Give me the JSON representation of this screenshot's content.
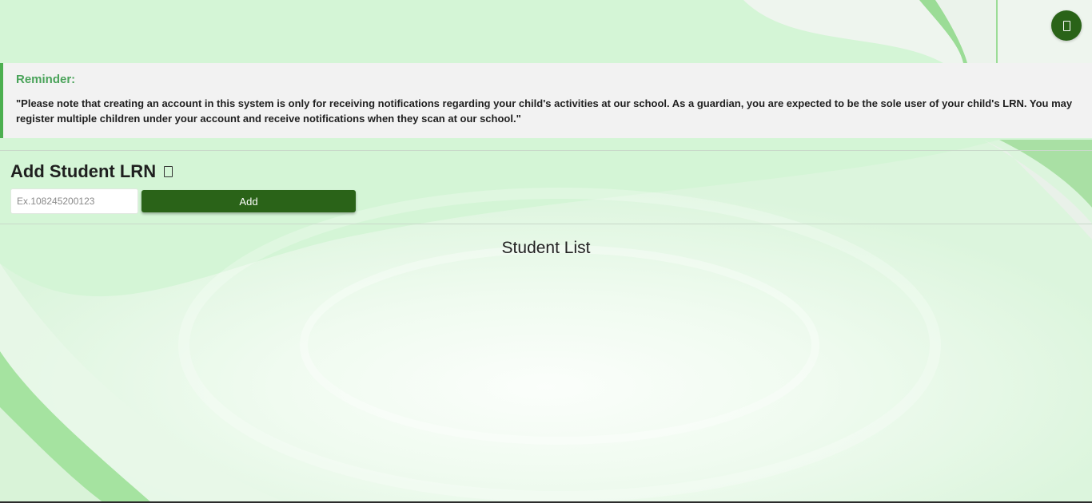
{
  "header": {
    "profile_icon": "profile-icon"
  },
  "reminder": {
    "title": "Reminder:",
    "text": "\"Please note that creating an account in this system is only for receiving notifications regarding your child's activities at our school. As a guardian, you are expected to be the sole user of your child's LRN. You may register multiple children under your account and receive notifications when they scan at our school.\""
  },
  "add_student": {
    "title": "Add Student LRN",
    "info_icon": "info-icon",
    "input_placeholder": "Ex.108245200123",
    "input_value": "",
    "button_label": "Add"
  },
  "student_list": {
    "title": "Student List"
  },
  "colors": {
    "accent": "#2a6318",
    "reminder_title": "#4aa35a",
    "reminder_border": "#4caf50",
    "background": "#d4f5d6"
  }
}
